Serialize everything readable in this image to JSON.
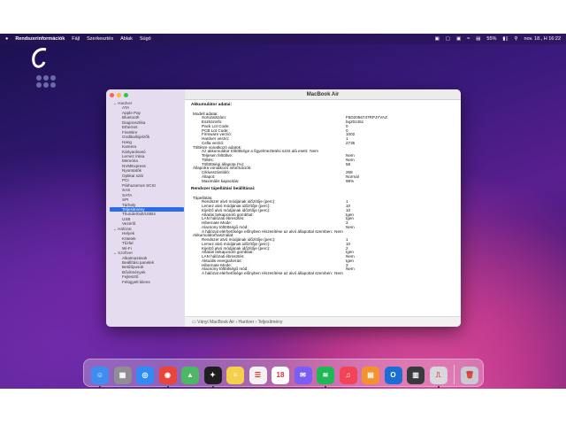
{
  "menubar": {
    "app_name": "Rendszerinformációk",
    "menus": [
      "Fájl",
      "Szerkesztés",
      "Ablak",
      "Súgó"
    ],
    "battery": "55%",
    "clock": "nov. 18., H 16:22"
  },
  "window": {
    "title": "MacBook Air",
    "status_path": "Ványi MacBook Air › Hardver › Teljesítmény"
  },
  "sidebar": {
    "groups": [
      {
        "label": "Hardver",
        "items": [
          "ATA",
          "Apple Pay",
          "Bluetooth",
          "Diagnosztika",
          "Ethernet",
          "FireWire",
          "Grafika/kijelzők",
          "Hang",
          "Kamera",
          "Kártyaolvasó",
          "Lemez írása",
          "Memória",
          "NVMExpress",
          "Nyomtatók",
          "Optikai szál",
          "PCI",
          "Párhuzamos SCSI",
          "SAS",
          "SATA",
          "SPI",
          "Tárhely",
          "Teljesítmény",
          "Thunderbolt/USB4",
          "USB",
          "Vezérlő"
        ]
      },
      {
        "label": "Hálózat",
        "items": [
          "Helyek",
          "Kötetek",
          "Tűzfal",
          "Wi-Fi"
        ]
      },
      {
        "label": "Szoftver",
        "items": [
          "Alkalmazások",
          "Beállítási panelek",
          "Betűtípusok",
          "Bővítmények",
          "Fejlesztő",
          "Felügyelt kliens"
        ]
      }
    ],
    "selected": "Teljesítmény"
  },
  "content": {
    "rows": [
      {
        "k": "Akkumulátor adatai:",
        "v": "",
        "lvl": 0,
        "h": true
      },
      {
        "k": "",
        "v": "",
        "lvl": 0
      },
      {
        "k": "Modell adatai:",
        "v": "",
        "lvl": 1
      },
      {
        "k": "Sorozatszám:",
        "v": "F5D2056747RPJYVAZ",
        "lvl": 2
      },
      {
        "k": "Eszközinfo:",
        "v": "bq20z451",
        "lvl": 2
      },
      {
        "k": "Pack Lot Code:",
        "v": "0",
        "lvl": 2
      },
      {
        "k": "PCB Lot Code:",
        "v": "0",
        "lvl": 2
      },
      {
        "k": "Firmware verzió:",
        "v": "1002",
        "lvl": 2
      },
      {
        "k": "Hardver verzió:",
        "v": "1",
        "lvl": 2
      },
      {
        "k": "Cella verzió:",
        "v": "2735",
        "lvl": 2
      },
      {
        "k": "Töltésre vonatkozó adatok:",
        "v": "",
        "lvl": 1
      },
      {
        "k": "Az akkumulátor töltöttsége a figyelmeztetési szint alá esett:",
        "v": "Nem",
        "lvl": 2
      },
      {
        "k": "Teljesen feltöltve:",
        "v": "Nem",
        "lvl": 2
      },
      {
        "k": "Töltés:",
        "v": "Nem",
        "lvl": 2
      },
      {
        "k": "Töltöttségi állapota (%):",
        "v": "58",
        "lvl": 2
      },
      {
        "k": "Állapotra vonatkozó információk:",
        "v": "",
        "lvl": 1
      },
      {
        "k": "Ciklusszámláló:",
        "v": "268",
        "lvl": 2
      },
      {
        "k": "Állapot:",
        "v": "Normál",
        "lvl": 2
      },
      {
        "k": "Maximális kapacitás:",
        "v": "98%",
        "lvl": 2
      },
      {
        "k": "",
        "v": "",
        "lvl": 0
      },
      {
        "k": "Rendszer tápellátási beállításai:",
        "v": "",
        "lvl": 0,
        "h": true
      },
      {
        "k": "",
        "v": "",
        "lvl": 0
      },
      {
        "k": "Tápellátás:",
        "v": "",
        "lvl": 1
      },
      {
        "k": "Rendszer alvó módjának időzítője (perc):",
        "v": "1",
        "lvl": 2
      },
      {
        "k": "Lemez alvó módjának időzítője (perc):",
        "v": "10",
        "lvl": 2
      },
      {
        "k": "Kijelző alvó módjának időzítője (perc):",
        "v": "10",
        "lvl": 2
      },
      {
        "k": "Altatás bekapcsoló gombbal:",
        "v": "Igen",
        "lvl": 2
      },
      {
        "k": "LAN hálózati ébresztés:",
        "v": "Igen",
        "lvl": 2
      },
      {
        "k": "Hibernate Mode:",
        "v": "3",
        "lvl": 2
      },
      {
        "k": "Alacsony töltöttségű mód:",
        "v": "Nem",
        "lvl": 2
      },
      {
        "k": "A hálózat elérhetősége előnyben részesítése az alvó állapottal szemben:",
        "v": "Nem",
        "lvl": 2
      },
      {
        "k": "Akkumulátorhasználat:",
        "v": "",
        "lvl": 1
      },
      {
        "k": "Rendszer alvó módjának időzítője (perc):",
        "v": "1",
        "lvl": 2
      },
      {
        "k": "Lemez alvó módjának időzítője (perc):",
        "v": "10",
        "lvl": 2
      },
      {
        "k": "Kijelző alvó módjának időzítője (perc):",
        "v": "2",
        "lvl": 2
      },
      {
        "k": "Altatás bekapcsoló gombbal:",
        "v": "Igen",
        "lvl": 2
      },
      {
        "k": "LAN hálózati ébresztés:",
        "v": "Nem",
        "lvl": 2
      },
      {
        "k": "Aktuális energiaforrás:",
        "v": "Igen",
        "lvl": 2
      },
      {
        "k": "Hibernate Mode:",
        "v": "3",
        "lvl": 2
      },
      {
        "k": "Alacsony töltöttségű mód:",
        "v": "Nem",
        "lvl": 2
      },
      {
        "k": "A hálózat elérhetősége előnyben részesítése az alvó állapottal szemben:",
        "v": "Nem",
        "lvl": 2
      }
    ]
  },
  "dock": {
    "apps": [
      {
        "name": "finder-icon",
        "color": "#3d8ef0",
        "glyph": "☺",
        "running": true
      },
      {
        "name": "launchpad-icon",
        "color": "#8e8e93",
        "glyph": "▦",
        "running": false
      },
      {
        "name": "safari-icon",
        "color": "#2f8bf5",
        "glyph": "◎",
        "running": false
      },
      {
        "name": "chrome-icon",
        "color": "#e8453c",
        "glyph": "◉",
        "running": true
      },
      {
        "name": "maps-icon",
        "color": "#4cb863",
        "glyph": "▲",
        "running": false
      },
      {
        "name": "figma-icon",
        "color": "#1e1e1e",
        "glyph": "✦",
        "running": true
      },
      {
        "name": "notes-icon",
        "color": "#f5d04c",
        "glyph": "≡",
        "running": false
      },
      {
        "name": "reminders-icon",
        "color": "#f2f2f2",
        "glyph": "☰",
        "running": false
      },
      {
        "name": "calendar-icon",
        "color": "#ffffff",
        "glyph": "18",
        "running": false
      },
      {
        "name": "messenger-icon",
        "color": "#7b5cf5",
        "glyph": "✉",
        "running": false
      },
      {
        "name": "spotify-icon",
        "color": "#1db954",
        "glyph": "≋",
        "running": true
      },
      {
        "name": "music-icon",
        "color": "#f24457",
        "glyph": "♫",
        "running": false
      },
      {
        "name": "books-icon",
        "color": "#f3922e",
        "glyph": "▤",
        "running": false
      },
      {
        "name": "outlook-icon",
        "color": "#1b6ed4",
        "glyph": "O",
        "running": false
      },
      {
        "name": "calculator-icon",
        "color": "#3a3a3c",
        "glyph": "▥",
        "running": false
      },
      {
        "name": "system-information-icon",
        "color": "#d8d8dc",
        "glyph": "⎍",
        "running": true
      },
      {
        "name": "trash-icon",
        "color": "#c8ccd2",
        "glyph": "🗑",
        "running": false
      }
    ]
  },
  "colors": {
    "selection": "#2a6ee6",
    "sidebar": "#e6dcef"
  }
}
